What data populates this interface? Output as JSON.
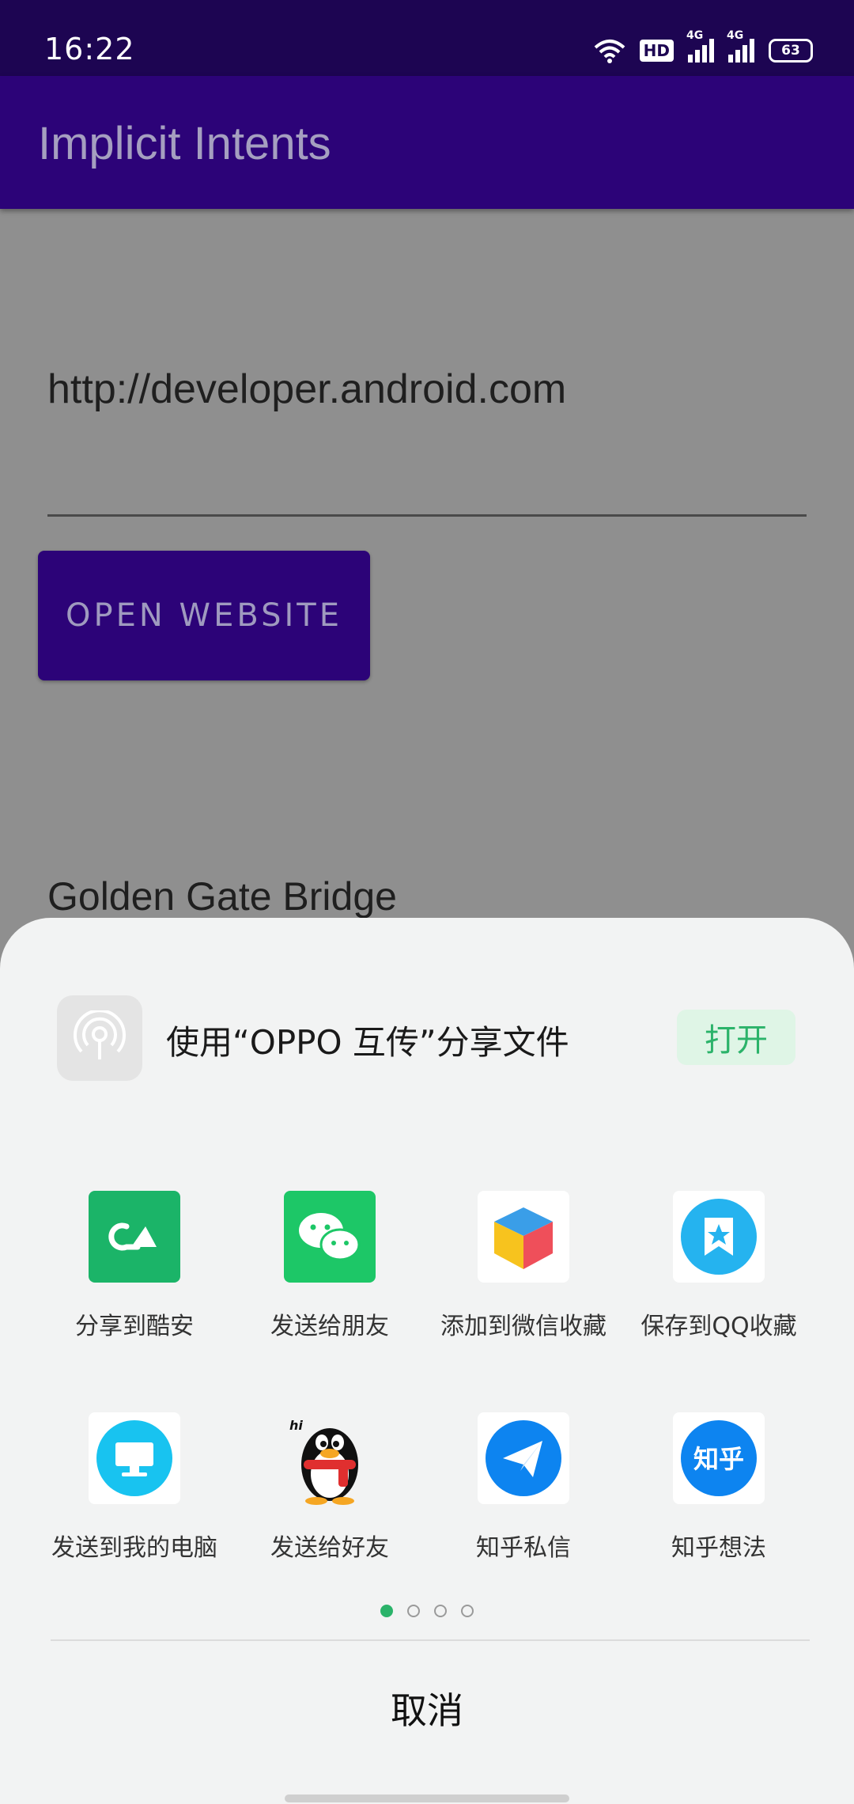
{
  "status": {
    "time": "16:22",
    "hd": "HD",
    "net1": "4G",
    "net2": "4G",
    "battery": "63"
  },
  "toolbar": {
    "title": "Implicit Intents"
  },
  "main": {
    "url_value": "http://developer.android.com",
    "open_button": "OPEN WEBSITE",
    "location_value": "Golden Gate Bridge"
  },
  "share_sheet": {
    "banner_text": "使用“OPPO 互传”分享文件",
    "banner_button": "打开",
    "targets": [
      {
        "label": "分享到酷安",
        "icon": "coolapk-icon"
      },
      {
        "label": "发送给朋友",
        "icon": "wechat-icon"
      },
      {
        "label": "添加到微信收藏",
        "icon": "wechat-favorites-icon"
      },
      {
        "label": "保存到QQ收藏",
        "icon": "qq-favorites-icon"
      },
      {
        "label": "发送到我的电脑",
        "icon": "computer-icon"
      },
      {
        "label": "发送给好友",
        "icon": "qq-penguin-icon"
      },
      {
        "label": "知乎私信",
        "icon": "zhihu-message-icon"
      },
      {
        "label": "知乎想法",
        "icon": "zhihu-icon"
      }
    ],
    "page_count": 4,
    "current_page": 1,
    "cancel": "取消"
  },
  "colors": {
    "accent": "#2c0378",
    "status_bar": "#1d0552",
    "green": "#2bb36a"
  }
}
